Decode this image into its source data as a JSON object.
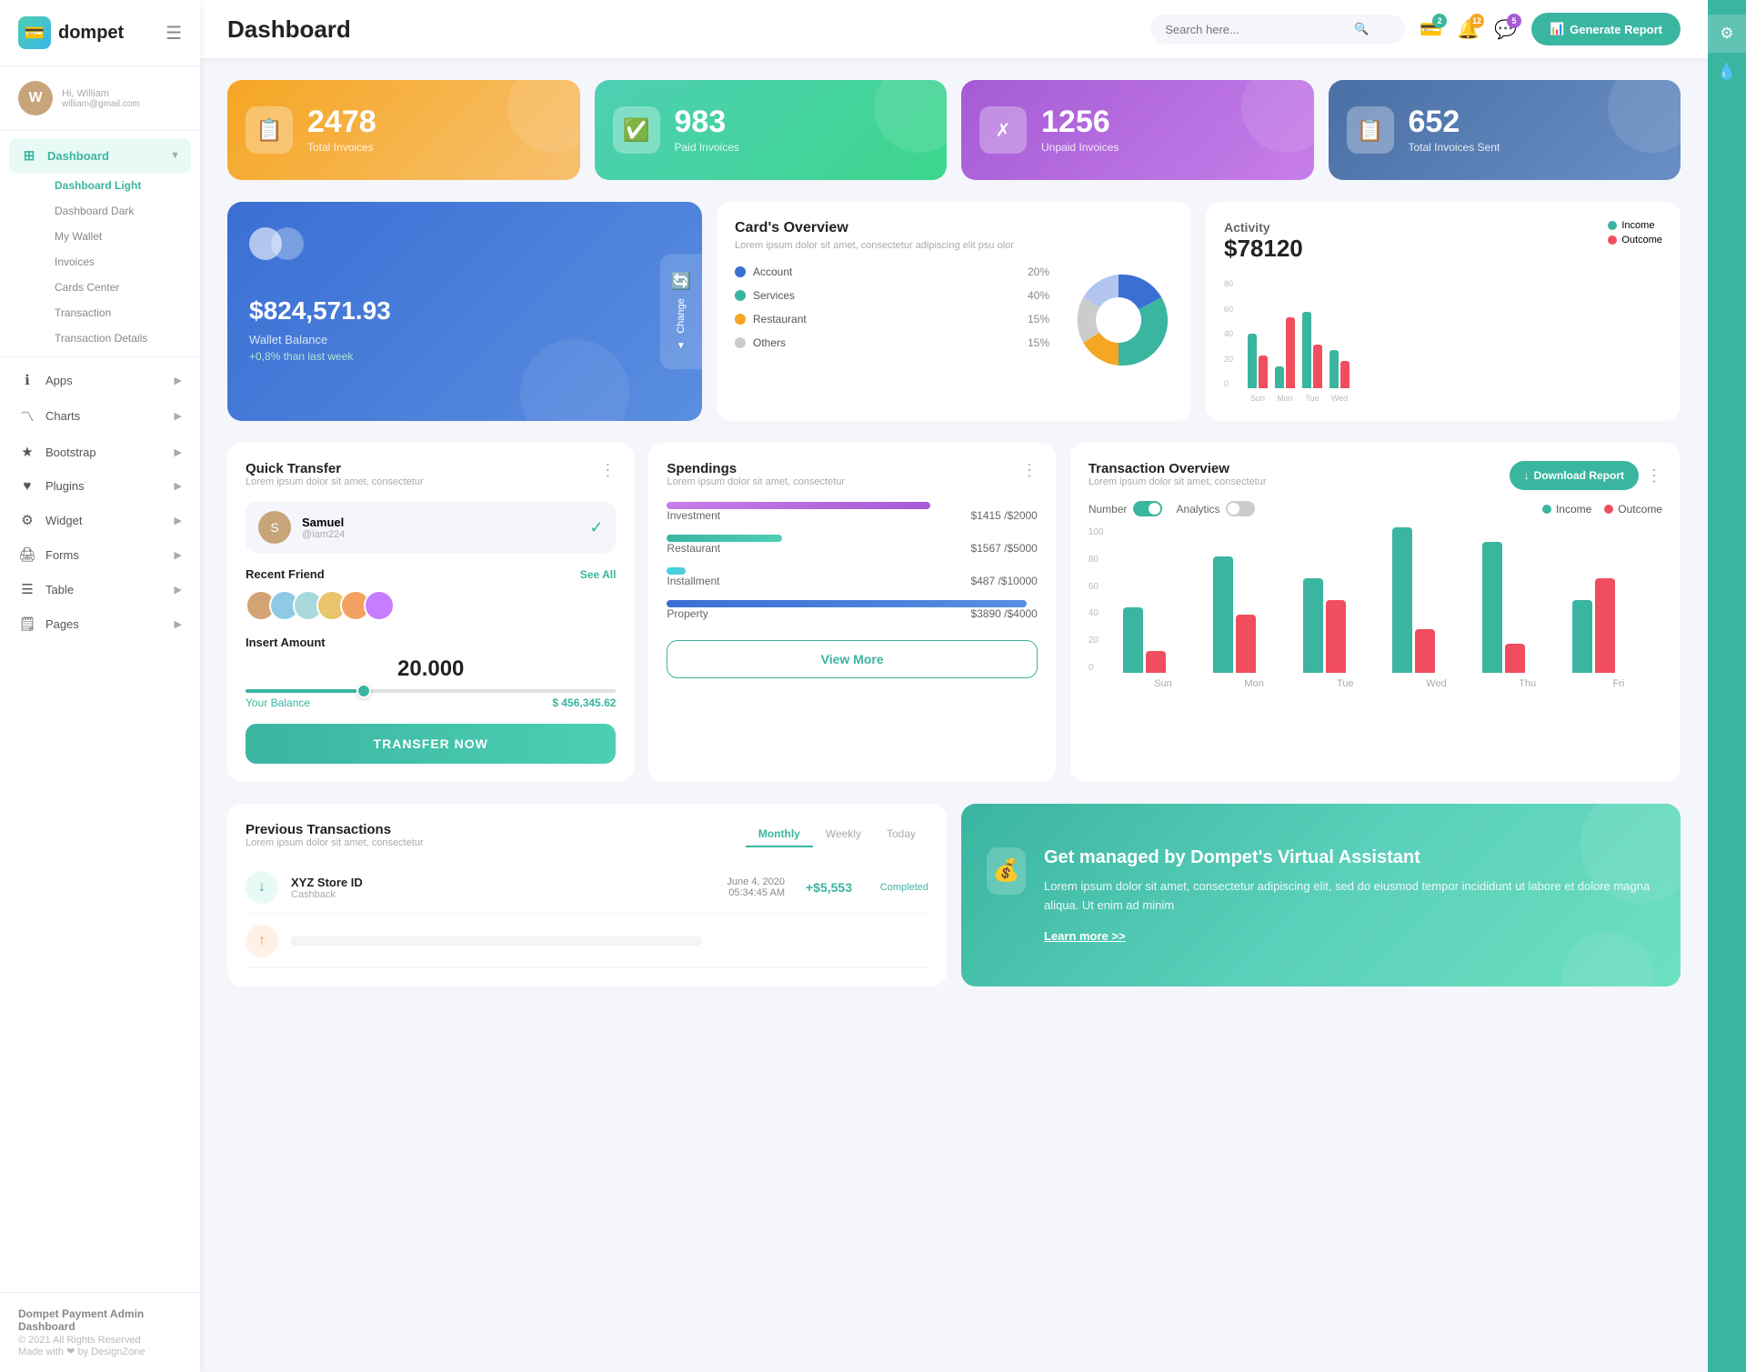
{
  "app": {
    "logo": "dompet",
    "logo_icon": "💳"
  },
  "user": {
    "greeting": "Hi, William",
    "name": "William",
    "email": "william@gmail.com",
    "avatar_initial": "W"
  },
  "header": {
    "title": "Dashboard",
    "search_placeholder": "Search here...",
    "generate_btn": "Generate Report",
    "notifications": {
      "wallet_count": "2",
      "bell_count": "12",
      "chat_count": "5"
    }
  },
  "sidebar": {
    "nav": [
      {
        "label": "Dashboard",
        "icon": "⊞",
        "active": true,
        "arrow": "▼"
      },
      {
        "label": "Dashboard Light",
        "sub": true,
        "active": true
      },
      {
        "label": "Dashboard Dark",
        "sub": true
      },
      {
        "label": "My Wallet",
        "sub": true
      },
      {
        "label": "Invoices",
        "sub": true
      },
      {
        "label": "Cards Center",
        "sub": true
      },
      {
        "label": "Transaction",
        "sub": true
      },
      {
        "label": "Transaction Details",
        "sub": true
      }
    ],
    "sections": [
      {
        "label": "Apps",
        "icon": "ℹ",
        "arrow": "▶"
      },
      {
        "label": "Charts",
        "icon": "〽",
        "arrow": "▶"
      },
      {
        "label": "Bootstrap",
        "icon": "★",
        "arrow": "▶"
      },
      {
        "label": "Plugins",
        "icon": "♥",
        "arrow": "▶"
      },
      {
        "label": "Widget",
        "icon": "⚙",
        "arrow": "▶"
      },
      {
        "label": "Forms",
        "icon": "🖨",
        "arrow": "▶"
      },
      {
        "label": "Table",
        "icon": "☰",
        "arrow": "▶"
      },
      {
        "label": "Pages",
        "icon": "🗒",
        "arrow": "▶"
      }
    ],
    "footer": {
      "title": "Dompet Payment Admin Dashboard",
      "copy": "© 2021 All Rights Reserved",
      "made_with": "Made with ❤ by DesignZone"
    }
  },
  "stats": [
    {
      "number": "2478",
      "label": "Total Invoices",
      "icon": "📋",
      "color": "orange"
    },
    {
      "number": "983",
      "label": "Paid Invoices",
      "icon": "✅",
      "color": "green"
    },
    {
      "number": "1256",
      "label": "Unpaid Invoices",
      "icon": "✗",
      "color": "purple"
    },
    {
      "number": "652",
      "label": "Total Invoices Sent",
      "icon": "📋",
      "color": "blue-dark"
    }
  ],
  "wallet": {
    "amount": "$824,571.93",
    "label": "Wallet Balance",
    "change": "+0,8% than last week",
    "change_btn": "Change"
  },
  "cards_overview": {
    "title": "Card's Overview",
    "subtitle": "Lorem ipsum dolor sit amet, consectetur adipiscing elit psu olor",
    "items": [
      {
        "label": "Account",
        "pct": "20%",
        "color": "blue"
      },
      {
        "label": "Services",
        "pct": "40%",
        "color": "teal"
      },
      {
        "label": "Restaurant",
        "pct": "15%",
        "color": "orange"
      },
      {
        "label": "Others",
        "pct": "15%",
        "color": "gray"
      }
    ]
  },
  "activity": {
    "title": "Activity",
    "amount": "$78120",
    "legend": [
      {
        "label": "Income",
        "color": "green"
      },
      {
        "label": "Outcome",
        "color": "red"
      }
    ],
    "bars": [
      {
        "day": "Sun",
        "income": 50,
        "outcome": 30
      },
      {
        "day": "Mon",
        "income": 20,
        "outcome": 65
      },
      {
        "day": "Tue",
        "income": 70,
        "outcome": 40
      },
      {
        "day": "Wed",
        "income": 35,
        "outcome": 25
      }
    ]
  },
  "quick_transfer": {
    "title": "Quick Transfer",
    "subtitle": "Lorem ipsum dolor sit amet, consectetur",
    "user": {
      "name": "Samuel",
      "handle": "@iam224"
    },
    "recent_title": "Recent Friend",
    "see_all": "See All",
    "insert_label": "Insert Amount",
    "amount": "20.000",
    "balance_label": "Your Balance",
    "balance": "$ 456,345.62",
    "transfer_btn": "TRANSFER NOW"
  },
  "spendings": {
    "title": "Spendings",
    "subtitle": "Lorem ipsum dolor sit amet, consectetur",
    "items": [
      {
        "label": "Investment",
        "amount": "$1415",
        "total": "$2000",
        "pct": 71,
        "color": "purple"
      },
      {
        "label": "Restaurant",
        "amount": "$1567",
        "total": "$5000",
        "pct": 31,
        "color": "teal"
      },
      {
        "label": "Installment",
        "amount": "$487",
        "total": "$10000",
        "pct": 5,
        "color": "cyan"
      },
      {
        "label": "Property",
        "amount": "$3890",
        "total": "$4000",
        "pct": 97,
        "color": "blue"
      }
    ],
    "view_more": "View More"
  },
  "transaction_overview": {
    "title": "Transaction Overview",
    "subtitle": "Lorem ipsum dolor sit amet, consectetur",
    "download_btn": "Download Report",
    "toggle1": {
      "label": "Number",
      "on": true
    },
    "toggle2": {
      "label": "Analytics",
      "on": false
    },
    "legend": [
      {
        "label": "Income",
        "color": "green"
      },
      {
        "label": "Outcome",
        "color": "red"
      }
    ],
    "bars": [
      {
        "day": "Sun",
        "income": 45,
        "outcome": 15
      },
      {
        "day": "Mon",
        "income": 80,
        "outcome": 40
      },
      {
        "day": "Tue",
        "income": 65,
        "outcome": 50
      },
      {
        "day": "Wed",
        "income": 100,
        "outcome": 30
      },
      {
        "day": "Thu",
        "income": 90,
        "outcome": 20
      },
      {
        "day": "Fri",
        "income": 50,
        "outcome": 65
      }
    ],
    "y_labels": [
      "0",
      "20",
      "40",
      "60",
      "80",
      "100"
    ]
  },
  "transactions": {
    "title": "Previous Transactions",
    "subtitle": "Lorem ipsum dolor sit amet, consectetur",
    "tabs": [
      "Monthly",
      "Weekly",
      "Today"
    ],
    "active_tab": "Monthly",
    "rows": [
      {
        "icon": "↓",
        "name": "XYZ Store ID",
        "type": "Cashback",
        "date": "June 4, 2020",
        "time": "05:34:45 AM",
        "amount": "+$5,553",
        "status": "Completed"
      }
    ]
  },
  "assistant": {
    "title": "Get managed by Dompet's Virtual Assistant",
    "desc": "Lorem ipsum dolor sit amet, consectetur adipiscing elit, sed do eiusmod tempor incididunt ut labore et dolore magna aliqua. Ut enim ad minim",
    "learn_more": "Learn more >>"
  }
}
